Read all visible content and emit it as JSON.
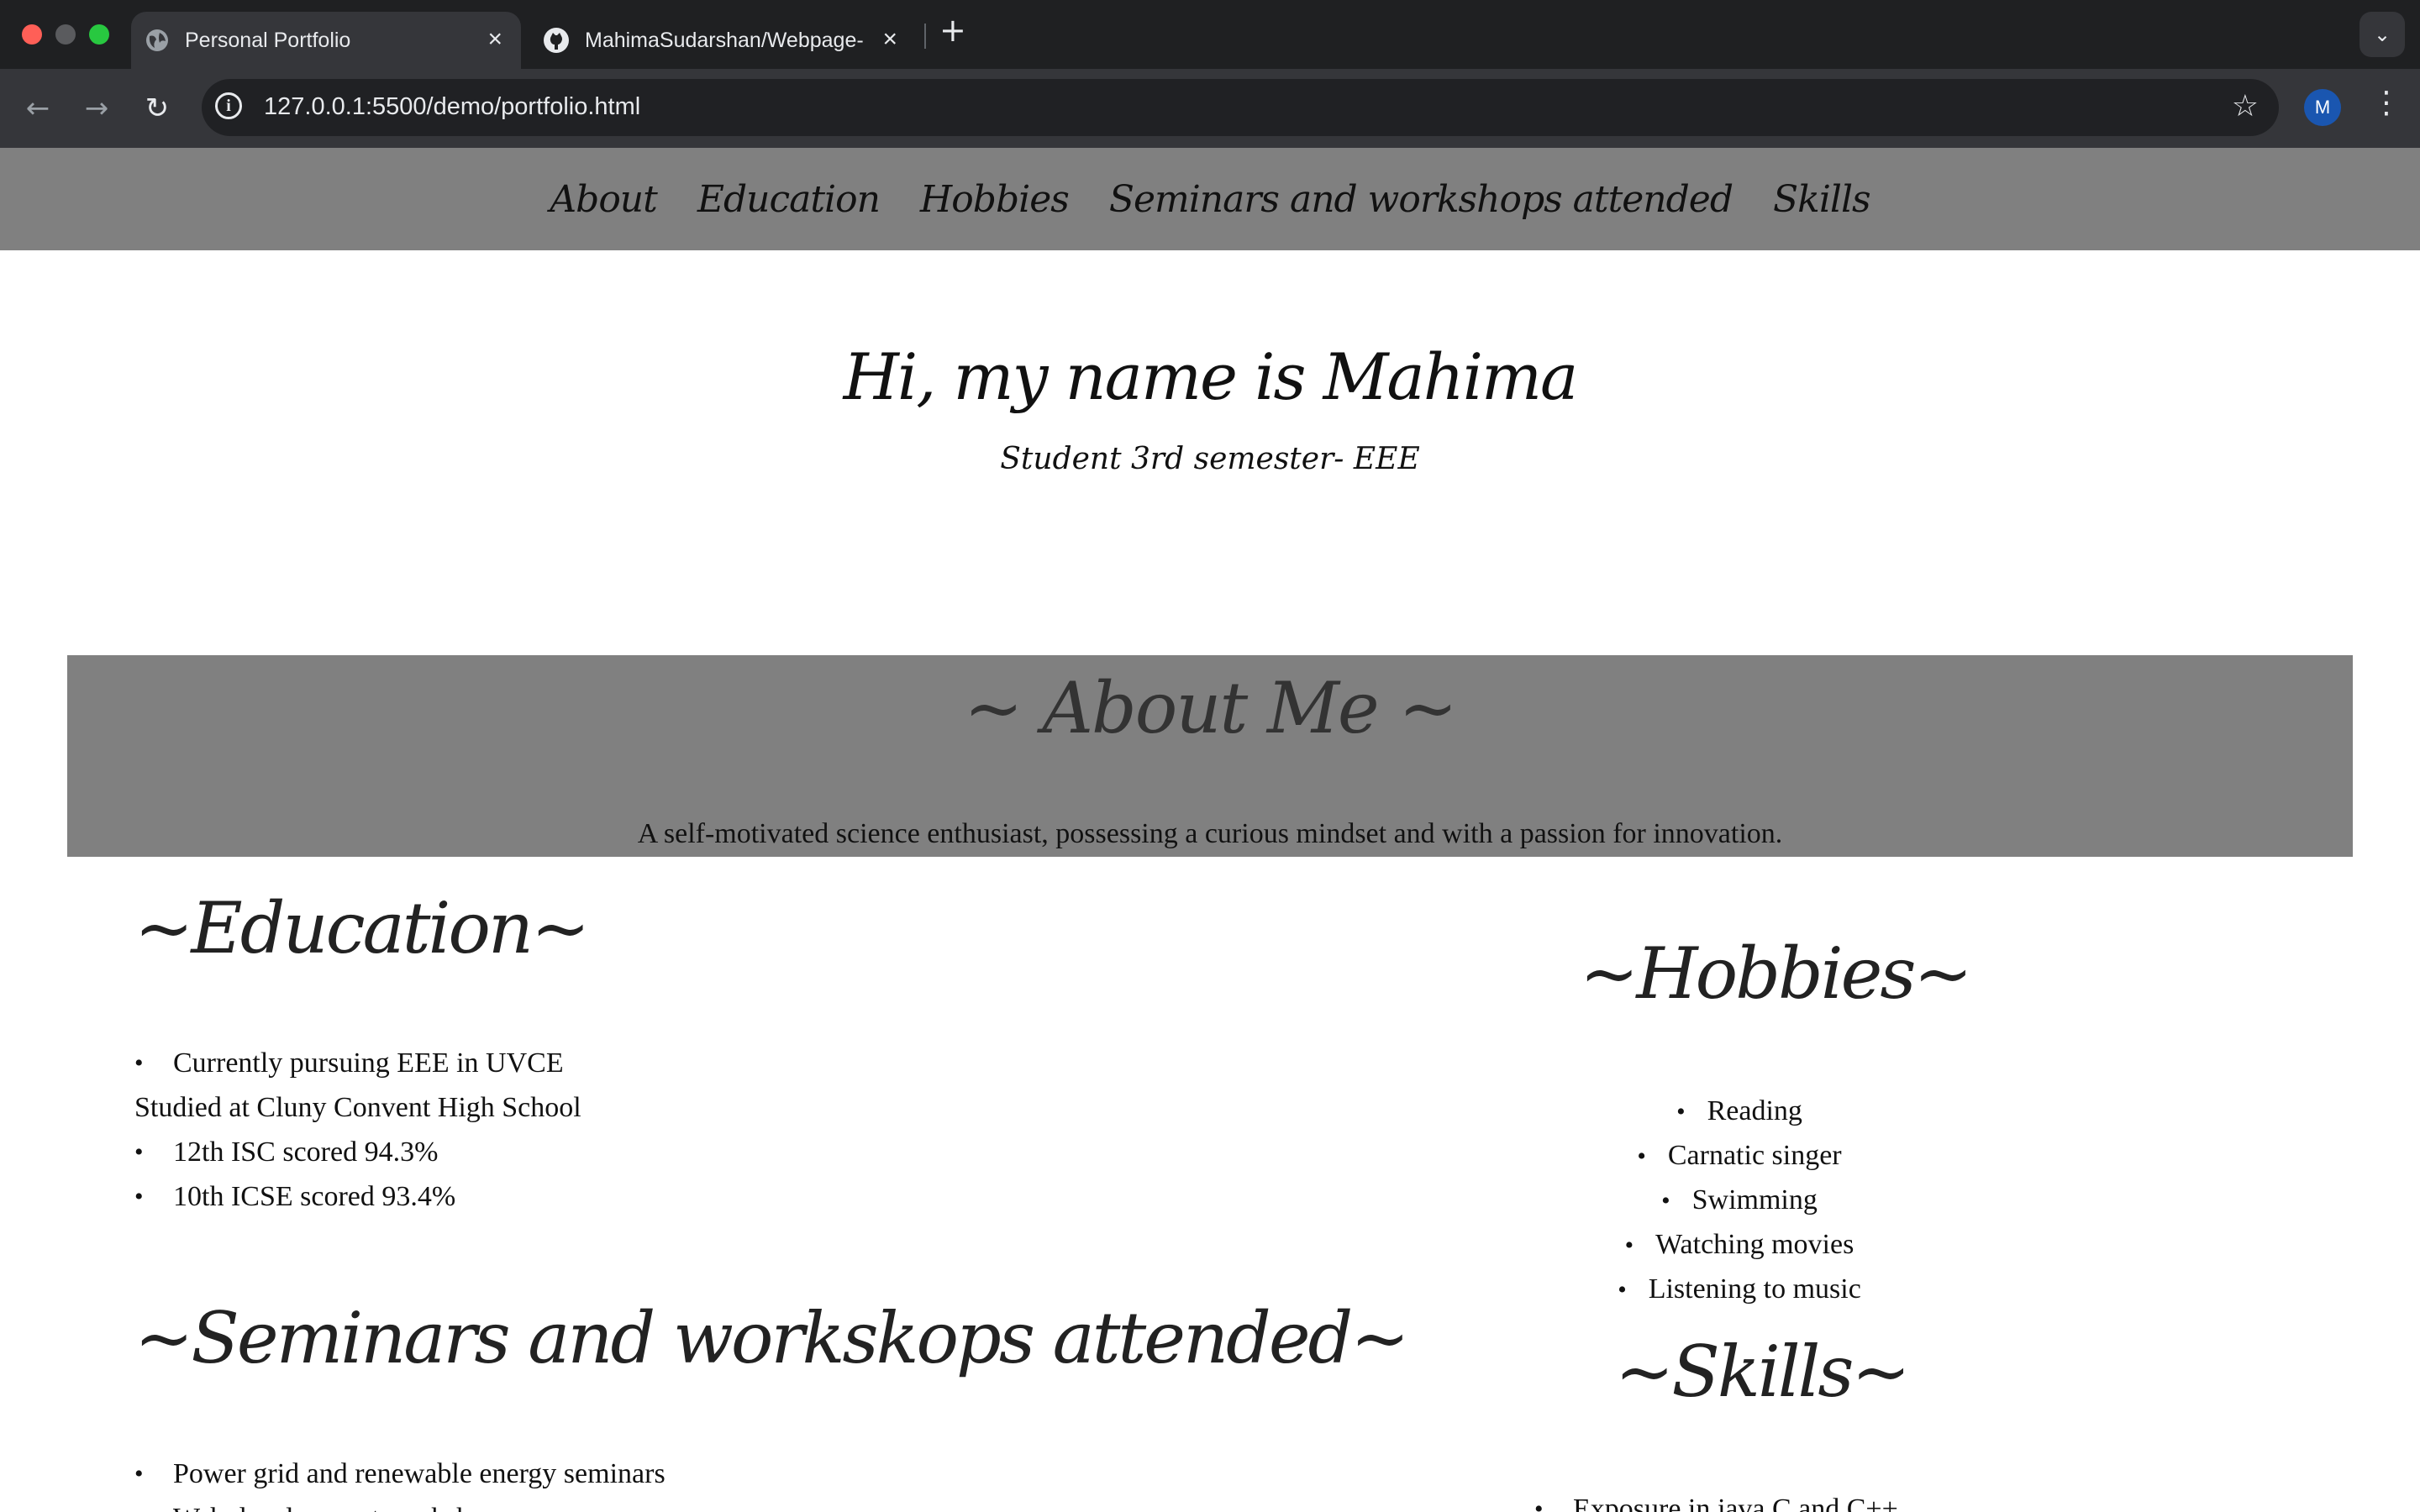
{
  "browser": {
    "tabs": [
      {
        "title": "Personal Portfolio",
        "icon": "globe-icon",
        "active": true
      },
      {
        "title": "MahimaSudarshan/Webpage-",
        "icon": "github-icon",
        "active": false
      }
    ],
    "url": "127.0.0.1:5500/demo/portfolio.html",
    "profile_initial": "M",
    "new_tab": "+"
  },
  "nav": {
    "items": [
      "About",
      "Education",
      "Hobbies",
      "Seminars and workshops attended",
      "Skills"
    ]
  },
  "hero": {
    "title": "Hi, my name is Mahima",
    "subtitle": "Student 3rd semester- EEE"
  },
  "about": {
    "heading": "~ About Me ~",
    "text": "A self-motivated science enthusiast, possessing a curious mindset and with a passion for innovation."
  },
  "education": {
    "heading": "~Education~",
    "items": [
      {
        "text": "Currently pursuing EEE in UVCE",
        "bullet": true
      },
      {
        "text": "Studied at Cluny Convent High School",
        "bullet": false
      },
      {
        "text": "12th ISC scored 94.3%",
        "bullet": true
      },
      {
        "text": "10th ICSE scored 93.4%",
        "bullet": true
      }
    ]
  },
  "seminars": {
    "heading": "~Seminars and workskops attended~",
    "items": [
      "Power grid and renewable energy seminars",
      "Web development workshop"
    ]
  },
  "hobbies": {
    "heading": "~Hobbies~",
    "items": [
      "Reading",
      "Carnatic singer",
      "Swimming",
      "Watching movies",
      "Listening to music"
    ]
  },
  "skills": {
    "heading": "~Skills~",
    "items": [
      "Exposure in java,C and C++"
    ]
  },
  "colors": {
    "nav_bg": "#808080",
    "about_bg": "#808080",
    "chrome_dark": "#1f2022",
    "chrome_toolbar": "#35363a"
  }
}
